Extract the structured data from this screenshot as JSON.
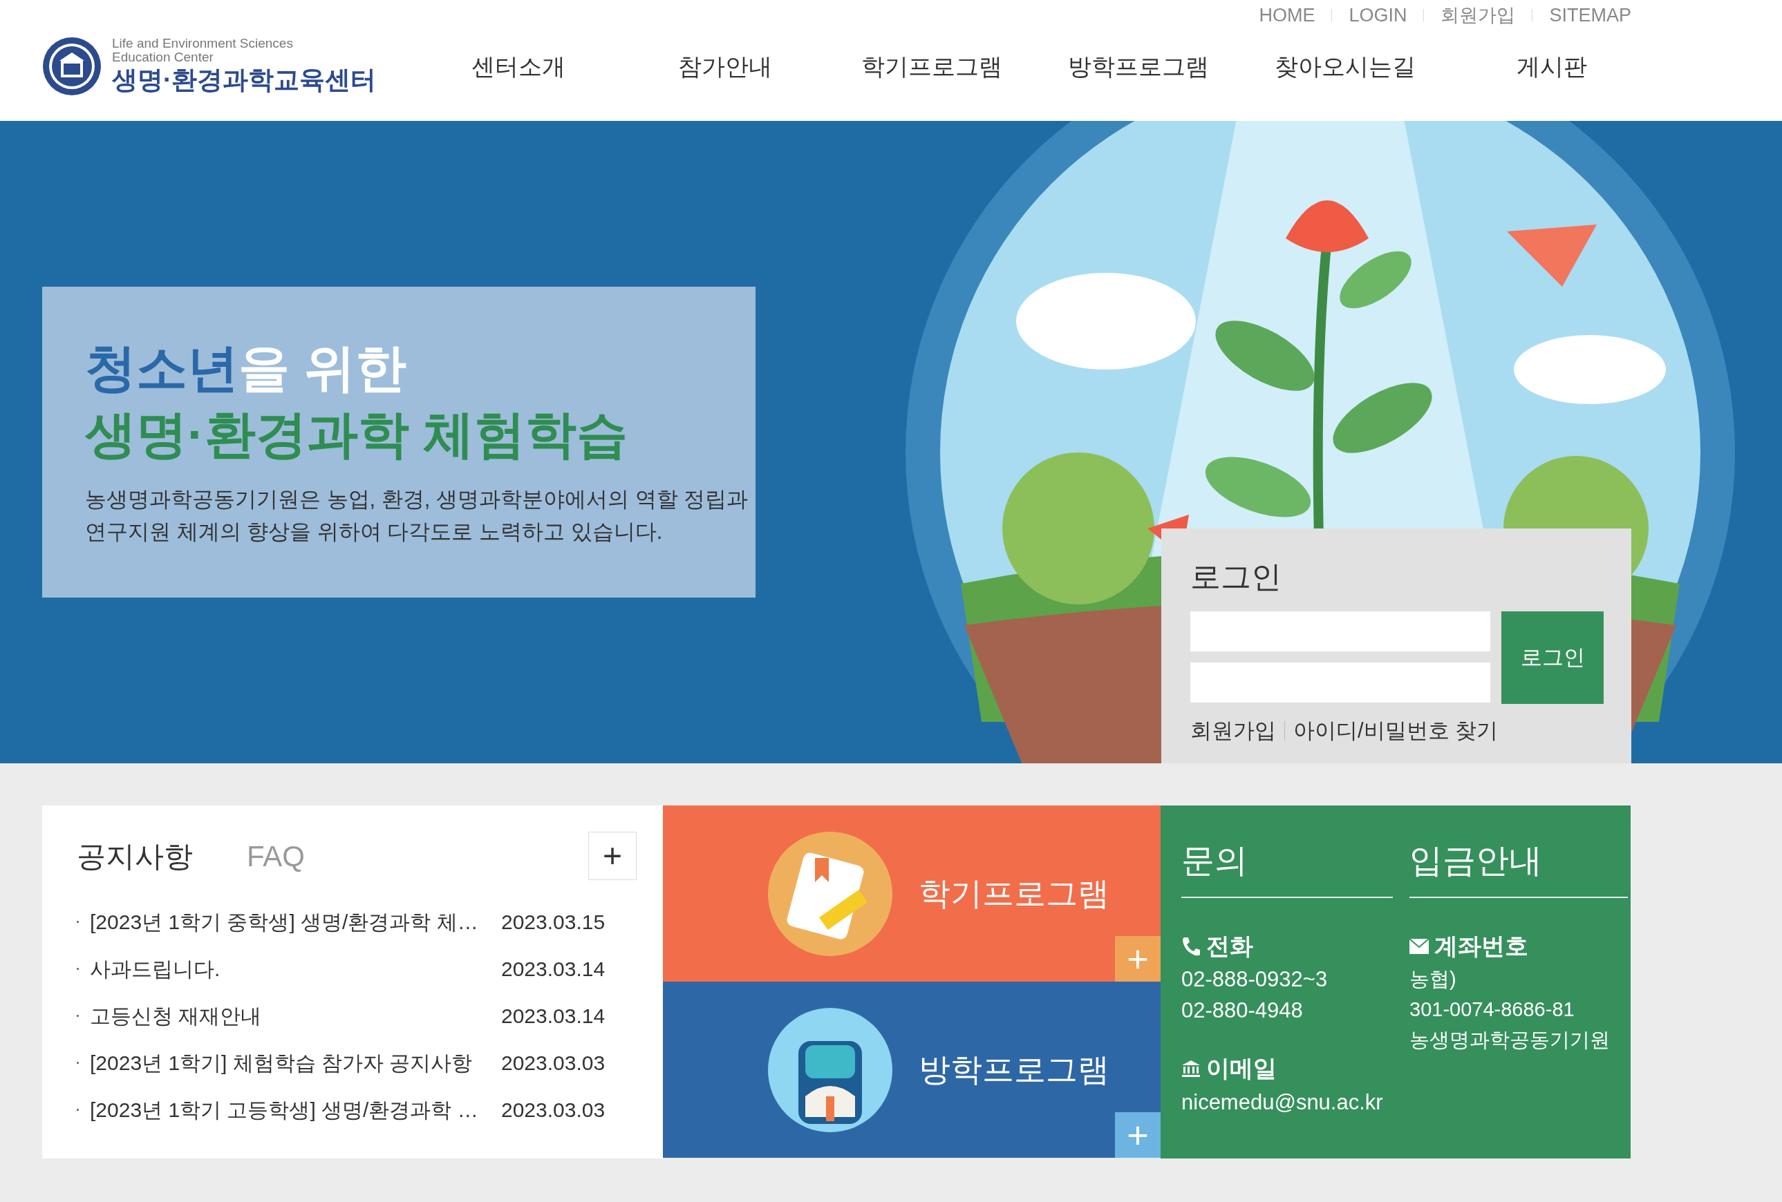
{
  "top_links": [
    "HOME",
    "LOGIN",
    "회원가입",
    "SITEMAP"
  ],
  "logo": {
    "english_lines": [
      "Life and Environment Sciences",
      "Education Center"
    ],
    "korean": "생명·환경과학교육센터"
  },
  "nav": [
    "센터소개",
    "참가안내",
    "학기프로그램",
    "방학프로그램",
    "찾아오시는길",
    "게시판"
  ],
  "hero": {
    "title_highlight": "청소년",
    "title_rest": "을 위한",
    "subtitle": "생명·환경과학 체험학습",
    "description_lines": [
      "농생명과학공동기기원은 농업, 환경, 생명과학분야에서의 역할 정립과",
      "연구지원 체계의 향상을 위하여 다각도로 노력하고 있습니다."
    ]
  },
  "login": {
    "title": "로그인",
    "button": "로그인",
    "links": [
      "회원가입",
      "아이디/비밀번호 찾기"
    ]
  },
  "notices": {
    "tabs": [
      {
        "label": "공지사항",
        "selected": true
      },
      {
        "label": "FAQ",
        "selected": false
      }
    ],
    "more": "+",
    "items": [
      {
        "title": "[2023년 1학기 중학생] 생명/환경과학 체…",
        "date": "2023.03.15"
      },
      {
        "title": "사과드립니다.",
        "date": "2023.03.14"
      },
      {
        "title": "고등신청 재재안내",
        "date": "2023.03.14"
      },
      {
        "title": "[2023년 1학기] 체험학습 참가자 공지사항",
        "date": "2023.03.03"
      },
      {
        "title": "[2023년 1학기 고등학생] 생명/환경과학 …",
        "date": "2023.03.03"
      }
    ]
  },
  "programs": [
    {
      "kind": "semester",
      "label": "학기프로그램",
      "more": "+"
    },
    {
      "kind": "vacation",
      "label": "방학프로그램",
      "more": "+"
    }
  ],
  "contact": {
    "inquiry": {
      "heading": "문의",
      "phone_label": "전화",
      "phones": [
        "02-888-0932~3",
        "02-880-4948"
      ],
      "email_label": "이메일",
      "email": "nicemedu@snu.ac.kr"
    },
    "deposit": {
      "heading": "입금안내",
      "account_label": "계좌번호",
      "lines": [
        "농협)",
        "301-0074-8686-81",
        "농생명과학공동기기원"
      ]
    }
  }
}
